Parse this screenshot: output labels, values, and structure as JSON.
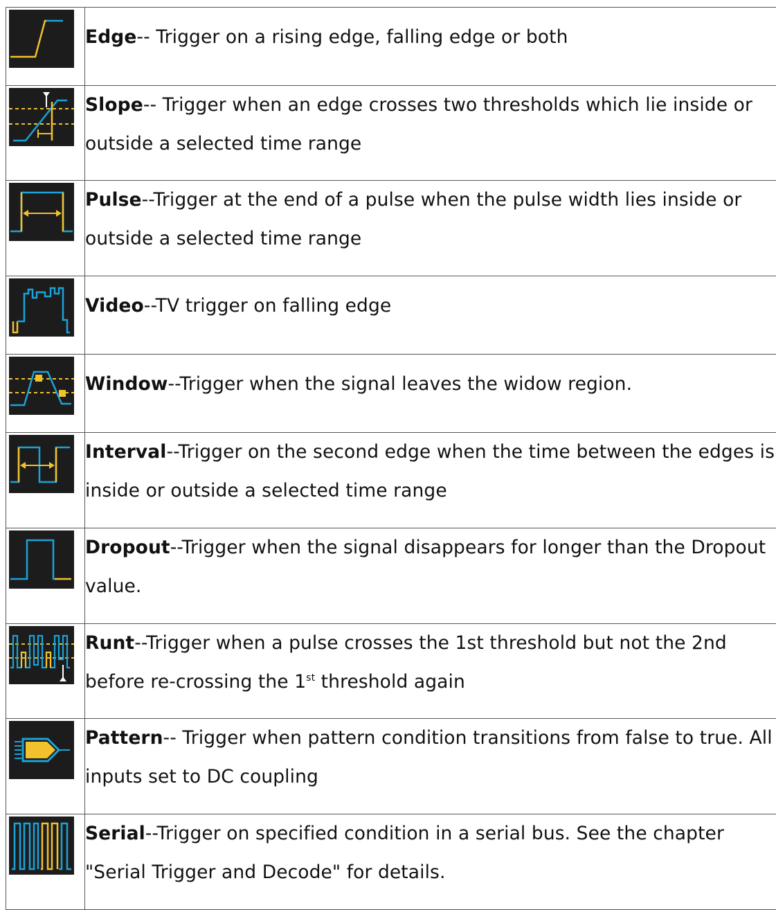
{
  "rows": [
    {
      "icon": "edge-trigger-icon",
      "name": "Edge",
      "desc": "-- Trigger on a rising edge, falling edge or both"
    },
    {
      "icon": "slope-trigger-icon",
      "name": "Slope",
      "desc": "-- Trigger when an edge crosses two thresholds which lie inside or outside a selected time range"
    },
    {
      "icon": "pulse-trigger-icon",
      "name": "Pulse",
      "desc": "--Trigger at the end of a pulse when the pulse width lies inside or outside a selected time range"
    },
    {
      "icon": "video-trigger-icon",
      "name": "Video",
      "desc": "--TV trigger on falling edge"
    },
    {
      "icon": "window-trigger-icon",
      "name": "Window",
      "desc": "--Trigger when the signal leaves the widow region."
    },
    {
      "icon": "interval-trigger-icon",
      "name": "Interval",
      "desc": "--Trigger on the second edge when the time between the edges is inside or outside a selected time range"
    },
    {
      "icon": "dropout-trigger-icon",
      "name": "Dropout",
      "desc": "--Trigger when the signal disappears for longer than the Dropout value."
    },
    {
      "icon": "runt-trigger-icon",
      "name": "Runt",
      "desc": "--Trigger when a pulse crosses the 1st threshold but not the 2nd before re-crossing the 1",
      "sup": "st",
      "desc_after": " threshold again"
    },
    {
      "icon": "pattern-trigger-icon",
      "name": "Pattern",
      "desc": "-- Trigger when pattern condition transitions from false to true. All inputs set to DC coupling"
    },
    {
      "icon": "serial-trigger-icon",
      "name": "Serial",
      "desc": "--Trigger on specified condition in a serial bus. See the chapter \"Serial Trigger and Decode\" for details."
    }
  ],
  "colors": {
    "icon_bg": "#1c1c1c",
    "blue": "#1aa3d9",
    "yellow": "#f2c12e",
    "white": "#ffffff"
  }
}
